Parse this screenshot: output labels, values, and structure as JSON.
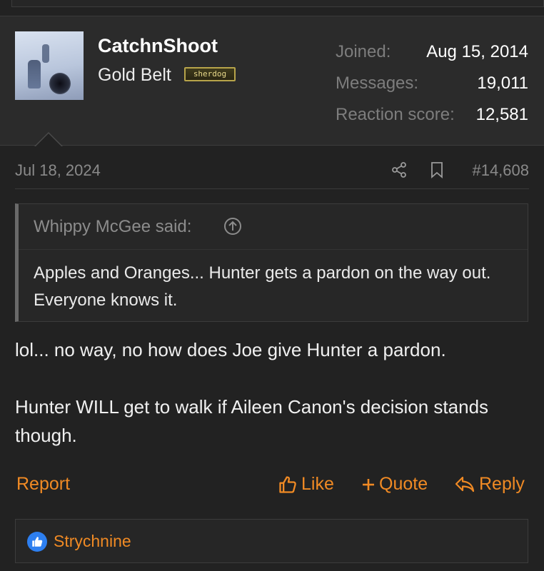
{
  "user": {
    "name": "CatchnShoot",
    "title": "Gold Belt",
    "badge_text": "sherdog",
    "stats": [
      {
        "label": "Joined:",
        "value": "Aug 15, 2014"
      },
      {
        "label": "Messages:",
        "value": "19,011"
      },
      {
        "label": "Reaction score:",
        "value": "12,581"
      }
    ]
  },
  "post": {
    "date": "Jul 18, 2024",
    "number": "#14,608",
    "quote": {
      "author": "Whippy McGee said:",
      "text": "Apples and Oranges... Hunter gets a pardon on the way out. Everyone knows it."
    },
    "paragraphs": [
      "lol... no way, no how does Joe give Hunter a pardon.",
      "Hunter WILL get to walk if Aileen Canon's decision stands though."
    ]
  },
  "actions": {
    "report": "Report",
    "like": "Like",
    "quote": "Quote",
    "reply": "Reply"
  },
  "reactions": {
    "user": "Strychnine"
  },
  "colors": {
    "accent": "#f08a24",
    "background": "#222222",
    "like_badge": "#2d7ff0"
  }
}
